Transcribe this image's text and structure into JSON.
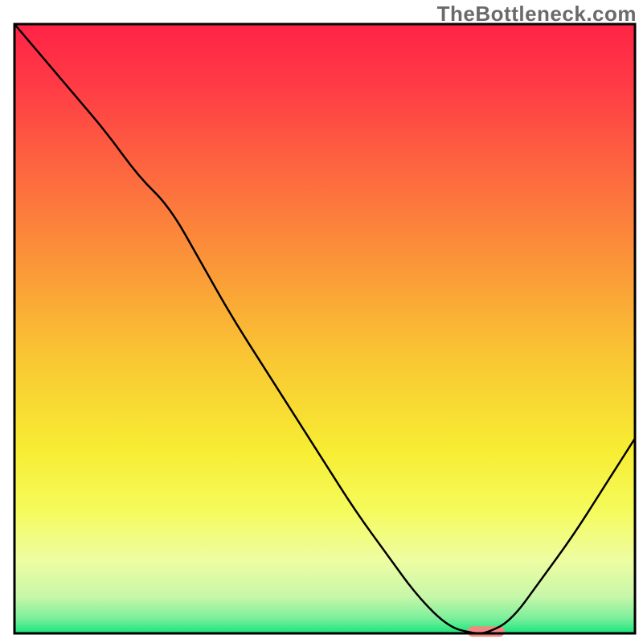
{
  "watermark": "TheBottleneck.com",
  "chart_data": {
    "type": "line",
    "title": "",
    "xlabel": "",
    "ylabel": "",
    "xlim": [
      0,
      100
    ],
    "ylim": [
      0,
      100
    ],
    "series": [
      {
        "name": "bottleneck-curve",
        "x": [
          0,
          5,
          10,
          15,
          20,
          25,
          30,
          35,
          40,
          45,
          50,
          55,
          60,
          65,
          70,
          74,
          76,
          80,
          85,
          90,
          95,
          100
        ],
        "y": [
          100,
          94,
          88,
          82,
          75,
          70,
          61,
          52,
          44,
          36,
          28,
          20,
          13,
          6,
          1,
          0,
          0,
          2,
          9,
          16,
          24,
          32
        ]
      }
    ],
    "marker": {
      "name": "optimal-range",
      "x_start": 73,
      "x_end": 79,
      "y": 0.3,
      "color": "#f08982"
    },
    "gradient_stops": [
      {
        "offset": 0.0,
        "color": "#ff2346"
      },
      {
        "offset": 0.1,
        "color": "#ff3b45"
      },
      {
        "offset": 0.25,
        "color": "#fd6a3f"
      },
      {
        "offset": 0.4,
        "color": "#fb9838"
      },
      {
        "offset": 0.55,
        "color": "#f9c733"
      },
      {
        "offset": 0.7,
        "color": "#f7ed33"
      },
      {
        "offset": 0.8,
        "color": "#f5fb5d"
      },
      {
        "offset": 0.88,
        "color": "#eefda2"
      },
      {
        "offset": 0.94,
        "color": "#c7f7a9"
      },
      {
        "offset": 0.975,
        "color": "#7cef9b"
      },
      {
        "offset": 1.0,
        "color": "#18e57c"
      }
    ],
    "frame_color": "#000000"
  }
}
